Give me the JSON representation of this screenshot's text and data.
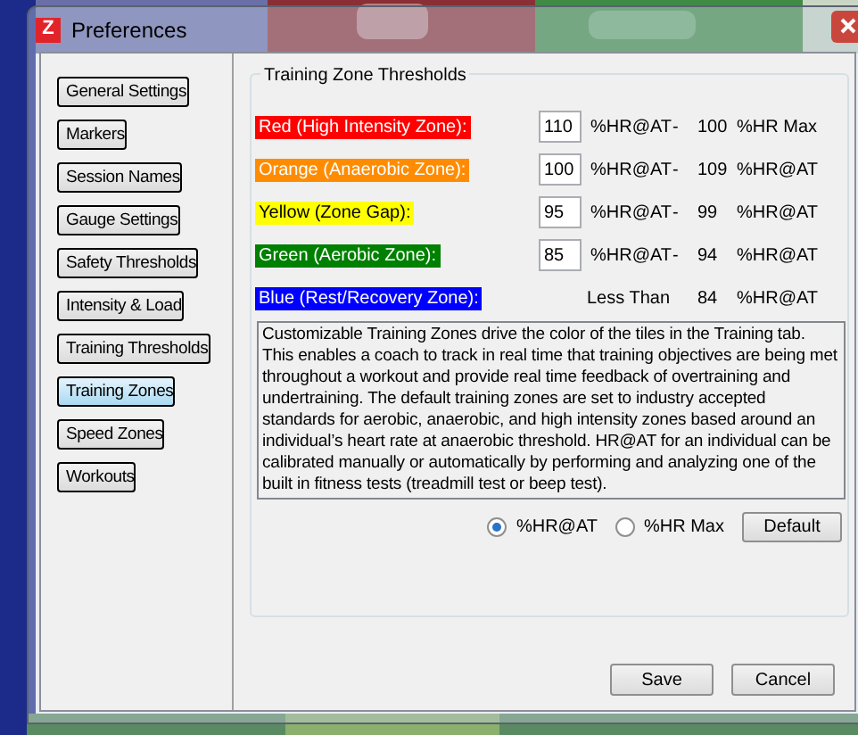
{
  "window": {
    "logo": "Z",
    "title": "Preferences"
  },
  "sidebar": {
    "items": [
      {
        "label": "General Settings",
        "selected": false
      },
      {
        "label": "Markers",
        "selected": false
      },
      {
        "label": "Session Names",
        "selected": false
      },
      {
        "label": "Gauge Settings",
        "selected": false
      },
      {
        "label": "Safety Thresholds",
        "selected": false
      },
      {
        "label": "Intensity & Load",
        "selected": false
      },
      {
        "label": "Training Thresholds",
        "selected": false
      },
      {
        "label": "Training Zones",
        "selected": true
      },
      {
        "label": "Speed Zones",
        "selected": false
      },
      {
        "label": "Workouts",
        "selected": false
      }
    ]
  },
  "group": {
    "title": "Training Zone Thresholds",
    "zones": [
      {
        "kind": "input",
        "label": "Red (High Intensity Zone):",
        "color": "#ff0000",
        "value": "110",
        "unit": "%HR@AT",
        "dash": "-",
        "upper": "100",
        "upper_unit": "%HR Max"
      },
      {
        "kind": "input",
        "label": "Orange (Anaerobic Zone):",
        "color": "#ff8c00",
        "value": "100",
        "unit": "%HR@AT",
        "dash": "-",
        "upper": "109",
        "upper_unit": "%HR@AT"
      },
      {
        "kind": "input",
        "label": "Yellow (Zone Gap):",
        "color": "#ffff00",
        "value": "95",
        "unit": "%HR@AT",
        "dash": "-",
        "upper": "99",
        "upper_unit": "%HR@AT"
      },
      {
        "kind": "input",
        "label": "Green (Aerobic Zone):",
        "color": "#008000",
        "value": "85",
        "unit": "%HR@AT",
        "dash": "-",
        "upper": "94",
        "upper_unit": "%HR@AT"
      },
      {
        "kind": "fixed",
        "label": "Blue (Rest/Recovery Zone):",
        "color": "#0000ff",
        "prefix": "Less Than",
        "upper": "84",
        "upper_unit": "%HR@AT"
      }
    ],
    "description": "Customizable Training Zones drive the color of the tiles in the Training tab.  This enables a coach to track in real time that training objectives are being met throughout a workout and provide real time feedback of overtraining and undertraining.  The default training zones are set to industry accepted standards for aerobic, anaerobic, and high intensity zones based around an individual’s heart rate at anaerobic threshold. HR@AT for an individual can be calibrated manually or automatically by performing and analyzing one of the built in fitness tests (treadmill test or beep test).",
    "options": [
      {
        "label": "%HR@AT",
        "selected": true
      },
      {
        "label": "%HR Max",
        "selected": false
      }
    ],
    "default_button": "Default"
  },
  "buttons": [
    "Save",
    "Cancel"
  ]
}
